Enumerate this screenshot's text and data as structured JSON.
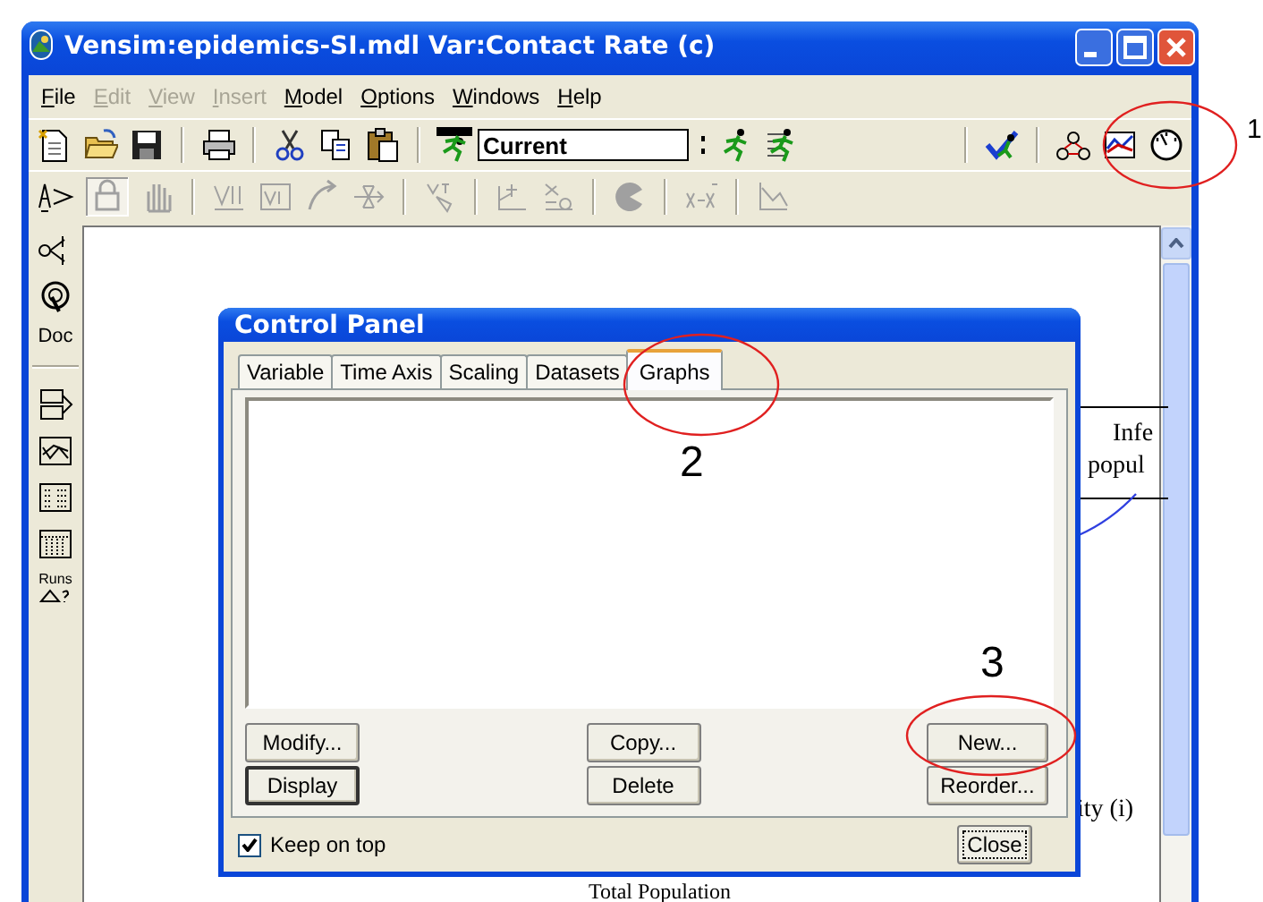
{
  "window": {
    "title": "Vensim:epidemics-SI.mdl Var:Contact Rate (c)"
  },
  "menu": [
    {
      "label": "File",
      "disabled": false
    },
    {
      "label": "Edit",
      "disabled": true
    },
    {
      "label": "View",
      "disabled": true
    },
    {
      "label": "Insert",
      "disabled": true
    },
    {
      "label": "Model",
      "disabled": false
    },
    {
      "label": "Options",
      "disabled": false
    },
    {
      "label": "Windows",
      "disabled": false
    },
    {
      "label": "Help",
      "disabled": false
    }
  ],
  "toolbar": {
    "run_name": "Current"
  },
  "side_tools": {
    "doc": "Doc",
    "runs": "Runs"
  },
  "canvas": {
    "variable_box": {
      "lines": [
        "Infe",
        "popul"
      ]
    },
    "labels": [
      "ity (i)",
      "Total Population"
    ]
  },
  "control_panel": {
    "title": "Control Panel",
    "tabs": [
      {
        "label": "Variable",
        "selected": false
      },
      {
        "label": "Time Axis",
        "selected": false
      },
      {
        "label": "Scaling",
        "selected": false
      },
      {
        "label": "Datasets",
        "selected": false
      },
      {
        "label": "Graphs",
        "selected": true
      }
    ],
    "buttons": [
      {
        "label": "Modify...",
        "default": false
      },
      {
        "label": "Copy...",
        "default": false
      },
      {
        "label": "New...",
        "default": false
      },
      {
        "label": "Display",
        "default": true
      },
      {
        "label": "Delete",
        "default": false
      },
      {
        "label": "Reorder...",
        "default": false
      }
    ],
    "keep_on_top": {
      "label": "Keep on top",
      "checked": true
    },
    "close": "Close"
  },
  "annotations": [
    {
      "number": "1"
    },
    {
      "number": "2"
    },
    {
      "number": "3"
    }
  ]
}
